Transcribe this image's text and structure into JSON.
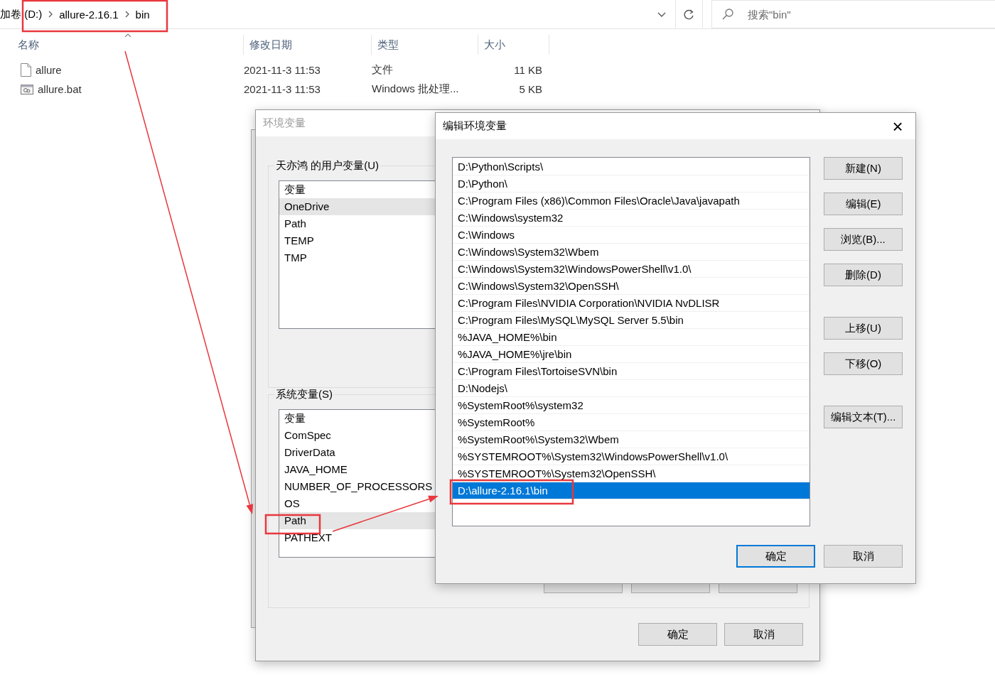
{
  "explorer": {
    "breadcrumb": [
      "加卷 (D:)",
      "allure-2.16.1",
      "bin"
    ],
    "search": {
      "placeholder": "搜索\"bin\""
    },
    "columns": [
      "名称",
      "修改日期",
      "类型",
      "大小"
    ],
    "files": [
      {
        "kind": "file",
        "name": "allure",
        "modified": "2021-11-3 11:53",
        "type": "文件",
        "size": "11 KB"
      },
      {
        "kind": "batch",
        "name": "allure.bat",
        "modified": "2021-11-3 11:53",
        "type": "Windows 批处理...",
        "size": "5 KB"
      }
    ]
  },
  "env_dialog": {
    "title": "环境变量",
    "user_group": {
      "title": "天亦鸿 的用户变量(U)",
      "header": "变量",
      "rows": [
        {
          "name": "OneDrive",
          "selected": true
        },
        {
          "name": "Path",
          "selected": false
        },
        {
          "name": "TEMP",
          "selected": false
        },
        {
          "name": "TMP",
          "selected": false
        }
      ]
    },
    "system_group": {
      "title": "系统变量(S)",
      "header": "变量",
      "rows": [
        {
          "name": "ComSpec",
          "selected": false
        },
        {
          "name": "DriverData",
          "selected": false
        },
        {
          "name": "JAVA_HOME",
          "selected": false
        },
        {
          "name": "NUMBER_OF_PROCESSORS",
          "selected": false
        },
        {
          "name": "OS",
          "selected": false
        },
        {
          "name": "Path",
          "selected": true
        },
        {
          "name": "PATHEXT",
          "selected": false
        }
      ]
    },
    "buttons": [
      "确定",
      "取消"
    ]
  },
  "edit_dialog": {
    "title": "编辑环境变量",
    "close": "×",
    "entries": [
      {
        "text": "D:\\Python\\Scripts\\",
        "selected": false
      },
      {
        "text": "D:\\Python\\",
        "selected": false
      },
      {
        "text": "C:\\Program Files (x86)\\Common Files\\Oracle\\Java\\javapath",
        "selected": false
      },
      {
        "text": "C:\\Windows\\system32",
        "selected": false
      },
      {
        "text": "C:\\Windows",
        "selected": false
      },
      {
        "text": "C:\\Windows\\System32\\Wbem",
        "selected": false
      },
      {
        "text": "C:\\Windows\\System32\\WindowsPowerShell\\v1.0\\",
        "selected": false
      },
      {
        "text": "C:\\Windows\\System32\\OpenSSH\\",
        "selected": false
      },
      {
        "text": "C:\\Program Files\\NVIDIA Corporation\\NVIDIA NvDLISR",
        "selected": false
      },
      {
        "text": "C:\\Program Files\\MySQL\\MySQL Server 5.5\\bin",
        "selected": false
      },
      {
        "text": "%JAVA_HOME%\\bin",
        "selected": false
      },
      {
        "text": "%JAVA_HOME%\\jre\\bin",
        "selected": false
      },
      {
        "text": "C:\\Program Files\\TortoiseSVN\\bin",
        "selected": false
      },
      {
        "text": "D:\\Nodejs\\",
        "selected": false
      },
      {
        "text": "%SystemRoot%\\system32",
        "selected": false
      },
      {
        "text": "%SystemRoot%",
        "selected": false
      },
      {
        "text": "%SystemRoot%\\System32\\Wbem",
        "selected": false
      },
      {
        "text": "%SYSTEMROOT%\\System32\\WindowsPowerShell\\v1.0\\",
        "selected": false
      },
      {
        "text": "%SYSTEMROOT%\\System32\\OpenSSH\\",
        "selected": false
      },
      {
        "text": "D:\\allure-2.16.1\\bin",
        "selected": true
      }
    ],
    "side_button_groups": [
      [
        "新建(N)",
        "编辑(E)",
        "浏览(B)...",
        "删除(D)"
      ],
      [
        "上移(U)",
        "下移(O)"
      ],
      [
        "编辑文本(T)..."
      ]
    ],
    "buttons": [
      {
        "label": "确定",
        "default": true
      },
      {
        "label": "取消",
        "default": false
      }
    ]
  }
}
